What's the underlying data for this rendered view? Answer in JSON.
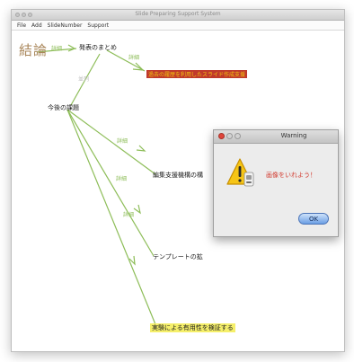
{
  "window": {
    "title": "Slide Preparing Support System"
  },
  "menubar": {
    "items": [
      "File",
      "Add",
      "SlideNumber",
      "Support"
    ]
  },
  "mindmap": {
    "root": "結論",
    "nodes": {
      "summary": "発表のまとめ",
      "future": "今後の課題",
      "slide_support": "過去の履歴を利用したスライド作成支援",
      "edit_support": "編集支援機構の構",
      "template": "テンプレートの拡",
      "experiment": "実験による有用性を検証する"
    },
    "edge_labels": {
      "root_summary": "詳細",
      "summary_slide": "詳細",
      "summary_future": "並列",
      "future_edit": "詳細",
      "future_template": "詳細",
      "future_experiment": "詳細"
    }
  },
  "dialog": {
    "title": "Warning",
    "message": "画像をいれよう！",
    "ok_label": "OK",
    "icon": "warning-triangle-icon"
  },
  "colors": {
    "edge": "#8dbd58",
    "root_text": "#a9865a",
    "highlight_red": "#c0392b",
    "highlight_yellow": "#f5ef6a",
    "warning_text": "#d23b2f"
  }
}
